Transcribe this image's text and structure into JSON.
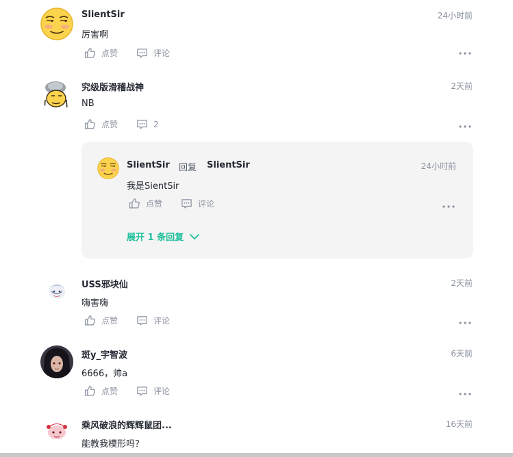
{
  "ui": {
    "like_label": "点赞",
    "comment_label": "评论",
    "more_label": "更多"
  },
  "comments": [
    {
      "user": "SlientSir",
      "time": "24小时前",
      "text": "厉害啊",
      "comment_action": "评论"
    },
    {
      "user": "究级版滑稽战神",
      "time": "2天前",
      "text": "NB",
      "comment_action": "2"
    },
    {
      "user": "USS邪块仙",
      "time": "2天前",
      "text": "嗨害嗨",
      "comment_action": "评论"
    },
    {
      "user": "斑y_宇智波",
      "time": "6天前",
      "text": "6666，帅a",
      "comment_action": "评论"
    },
    {
      "user": "乘风破浪的辉辉鼠团...",
      "time": "16天前",
      "text": "能教我模形吗？"
    }
  ],
  "reply": {
    "user": "SlientSir",
    "reply_word": "回复",
    "target": "SlientSir",
    "time": "24小时前",
    "text": "我是SientSir",
    "expand_label": "展开 1 条回复"
  },
  "colors": {
    "accent": "#1dbf9b",
    "muted": "#8a919f",
    "text": "#252933",
    "reply_bg": "#f4f4f4"
  }
}
